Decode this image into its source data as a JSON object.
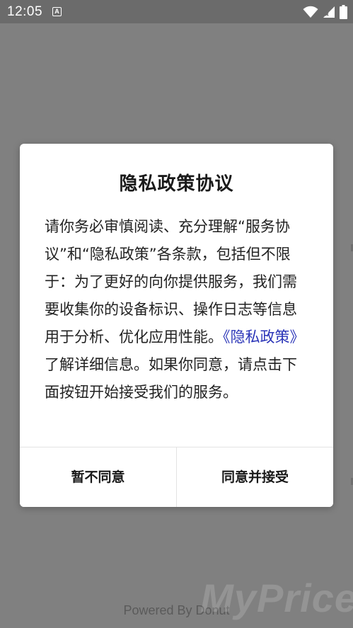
{
  "status_bar": {
    "time": "12:05",
    "app_icon_letter": "A",
    "icons": [
      "wifi-icon",
      "signal-icon",
      "battery-icon"
    ]
  },
  "dialog": {
    "title": "隐私政策协议",
    "body_intro": "请你务必审慎阅读、充分理解“服务协议”和“隐私政策”各条款，包括但不限于：为了更好的向你提供服务，我们需要收集你的设备标识、操作日志等信息用于分析、优化应用性能。",
    "policy_link": "《隐私政策》",
    "body_outro": "了解详细信息。如果你同意，请点击下面按钮开始接受我们的服务。",
    "disagree_label": "暂不同意",
    "agree_label": "同意并接受"
  },
  "footer": {
    "powered_by": "Powered By Donut",
    "watermark": "MyPrice"
  },
  "colors": {
    "overlay": "#808080",
    "status_bar": "#6b6b6b",
    "link": "#2b35b8",
    "dialog_bg": "#ffffff"
  }
}
